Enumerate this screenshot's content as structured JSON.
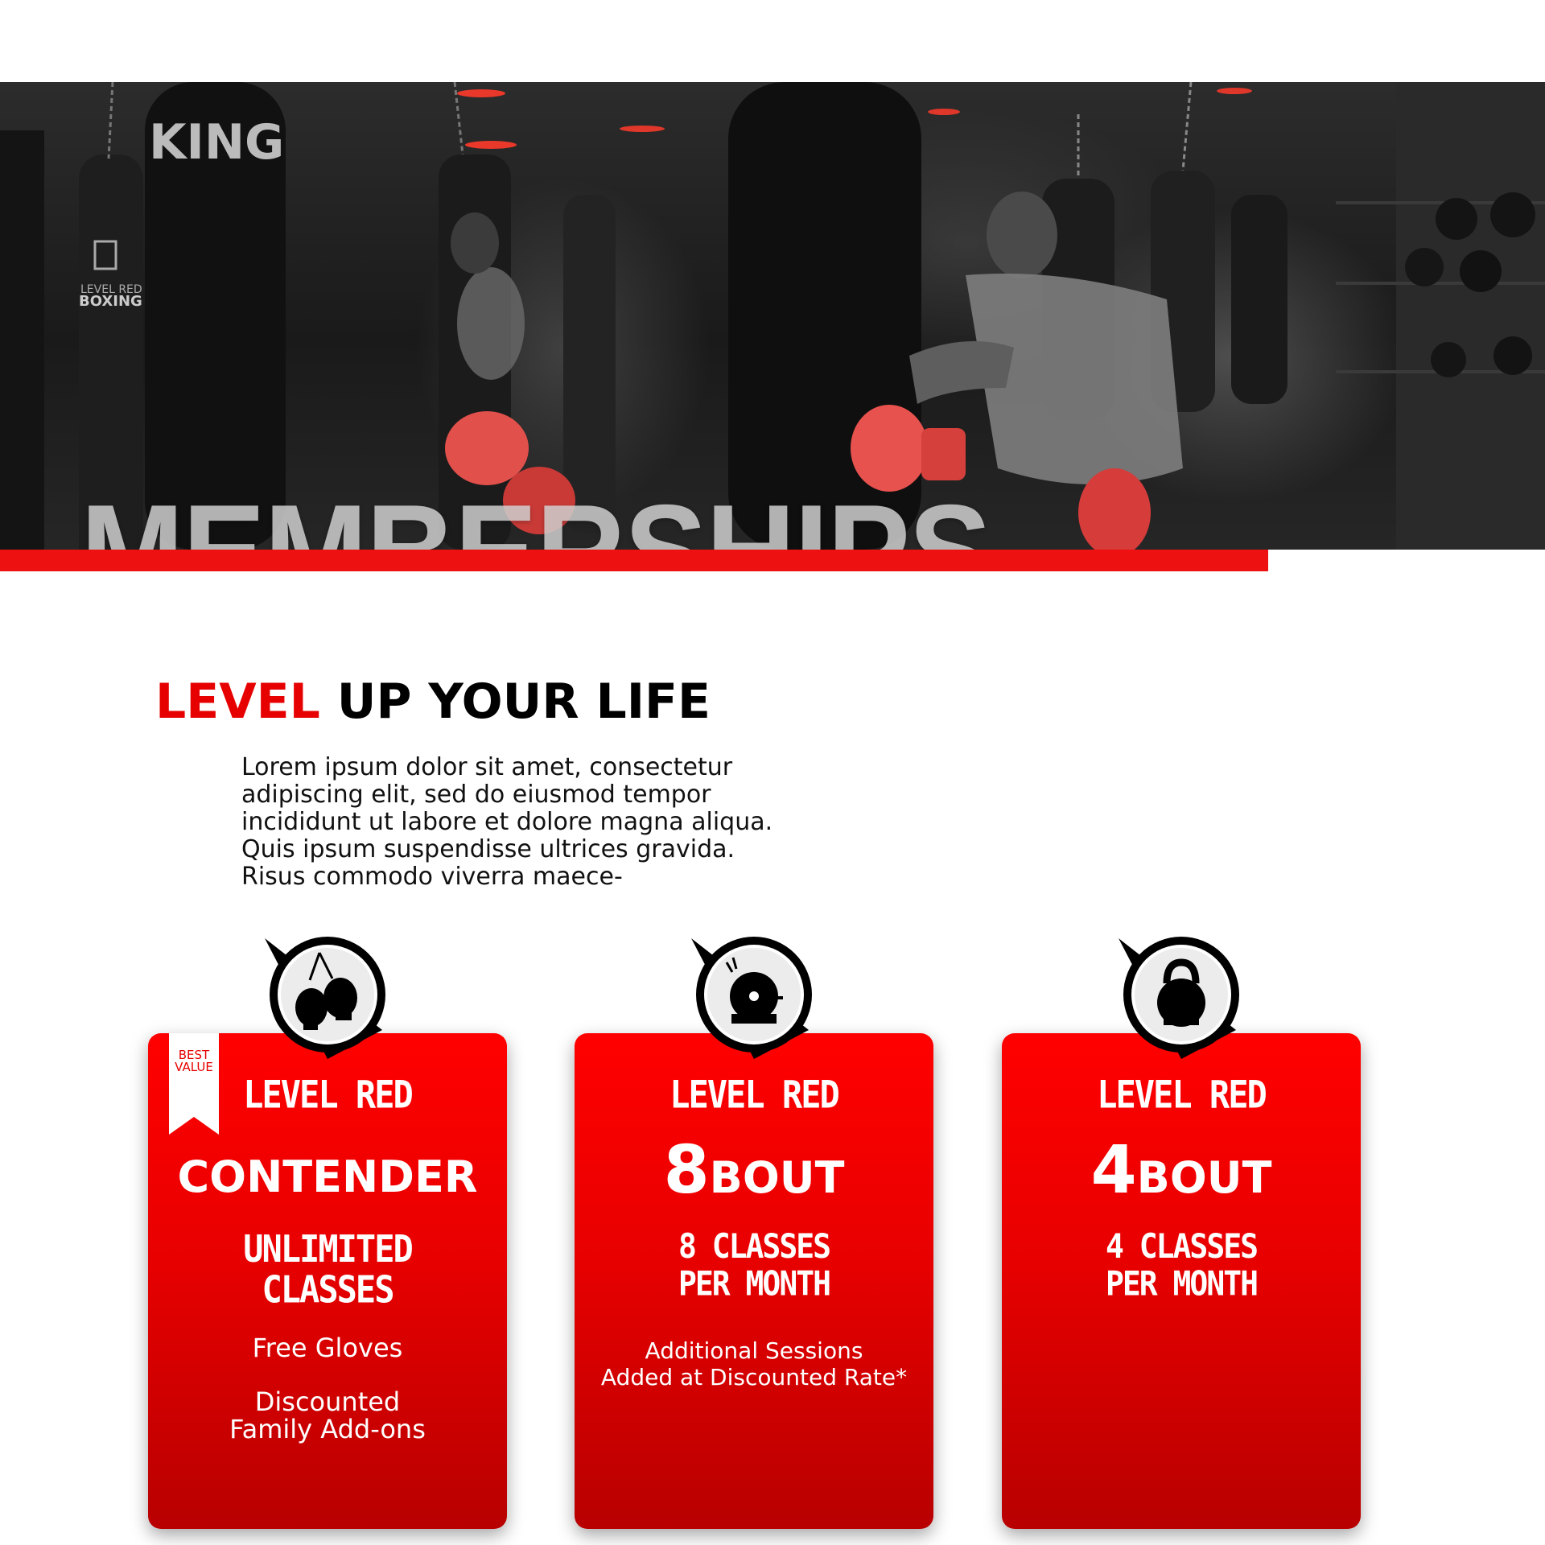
{
  "hero": {
    "title": "MEMBERSHIPS",
    "accent_color": "#ee1111"
  },
  "intro": {
    "headline_accent": "LEVEL",
    "headline_rest": "UP YOUR LIFE",
    "body": "Lorem ipsum dolor sit amet, consectetur adipiscing elit, sed do eiusmod tempor incididunt ut labore et dolore magna aliqua. Quis ipsum suspendisse ultrices gravida. Risus commodo viverra maece-"
  },
  "cards": [
    {
      "icon": "boxing-gloves-icon",
      "ribbon_line1": "BEST",
      "ribbon_line2": "VALUE",
      "tier": "LEVEL RED",
      "plan": "CONTENDER",
      "classes_line1": "UNLIMITED",
      "classes_line2": "CLASSES",
      "perk1": "Free Gloves",
      "perk2_line1": "Discounted",
      "perk2_line2": "Family Add-ons"
    },
    {
      "icon": "bell-icon",
      "tier": "LEVEL RED",
      "plan_number": "8",
      "plan_word": "BOUT",
      "classes_line1": "8 CLASSES",
      "classes_line2": "PER MONTH",
      "perk1_line1": "Additional Sessions",
      "perk1_line2": "Added at Discounted Rate*"
    },
    {
      "icon": "kettlebell-icon",
      "tier": "LEVEL RED",
      "plan_number": "4",
      "plan_word": "BOUT",
      "classes_line1": "4 CLASSES",
      "classes_line2": "PER MONTH"
    }
  ],
  "colors": {
    "brand_red": "#e60000",
    "card_gradient_top": "#ff0000",
    "card_gradient_bottom": "#b80000"
  }
}
